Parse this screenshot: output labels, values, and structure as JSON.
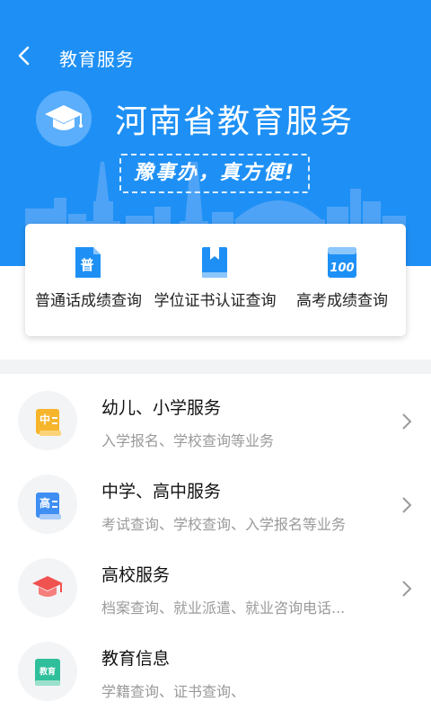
{
  "header": {
    "nav_title": "教育服务",
    "hero_title": "河南省教育服务",
    "slogan": "豫事办，真方便!"
  },
  "quick_actions": [
    {
      "label": "普通话成绩查询",
      "icon": "pu-doc-icon",
      "glyph": "普"
    },
    {
      "label": "学位证书认证查询",
      "icon": "bookmark-book-icon",
      "glyph": ""
    },
    {
      "label": "高考成绩查询",
      "icon": "score-100-icon",
      "glyph": "100"
    }
  ],
  "services": [
    {
      "title": "幼儿、小学服务",
      "subtitle": "入学报名、学校查询等业务",
      "icon": "primary-school-icon",
      "glyph": "中"
    },
    {
      "title": "中学、高中服务",
      "subtitle": "考试查询、学校查询、入学报名等业务",
      "icon": "high-school-icon",
      "glyph": "高"
    },
    {
      "title": "高校服务",
      "subtitle": "档案查询、就业派遣、就业咨询电话...",
      "icon": "graduation-cap-icon",
      "glyph": ""
    },
    {
      "title": "教育信息",
      "subtitle": "学籍查询、证书查询、",
      "icon": "education-book-icon",
      "glyph": "教育"
    }
  ],
  "colors": {
    "primary": "#1e90f5",
    "card_bg": "#ffffff",
    "row_icon_bg": "#f3f4f6"
  }
}
